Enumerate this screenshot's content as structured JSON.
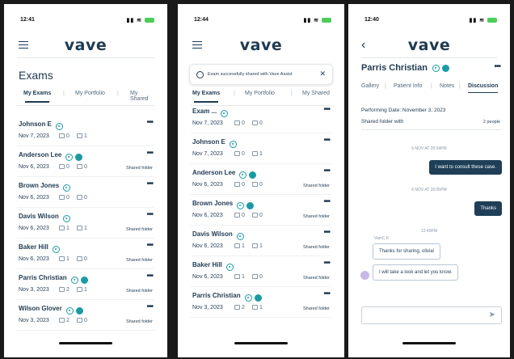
{
  "brand": "vave",
  "colors": {
    "navy": "#1f3a52",
    "teal": "#1a9aa5",
    "bubble": "#1e3f57"
  },
  "screen1": {
    "time": "12:41",
    "title": "Exams",
    "tabs": [
      "My Exams",
      "My Portfolio",
      "My Shared"
    ],
    "rows": [
      {
        "name": "Johnson E",
        "badge": false,
        "date": "Nov 7, 2023",
        "images": "0",
        "notes": "1",
        "shared": ""
      },
      {
        "name": "Anderson Lee",
        "badge": true,
        "date": "Nov 6, 2023",
        "images": "0",
        "notes": "0",
        "shared": "Shared folder"
      },
      {
        "name": "Brown Jones",
        "badge": false,
        "date": "Nov 6, 2023",
        "images": "0",
        "notes": "0",
        "shared": ""
      },
      {
        "name": "Davis Wilson",
        "badge": false,
        "date": "Nov 6, 2023",
        "images": "1",
        "notes": "1",
        "shared": "Shared folder"
      },
      {
        "name": "Baker Hill",
        "badge": false,
        "date": "Nov 6, 2023",
        "images": "1",
        "notes": "0",
        "shared": "Shared folder"
      },
      {
        "name": "Parris Christian",
        "badge": true,
        "date": "Nov 3, 2023",
        "images": "2",
        "notes": "1",
        "shared": "Shared folder"
      },
      {
        "name": "Wilson Glover",
        "badge": true,
        "date": "Nov 3, 2023",
        "images": "2",
        "notes": "0",
        "shared": "Shared folder"
      }
    ]
  },
  "screen2": {
    "time": "12:44",
    "toast": "Exam successfully shared with Vave Assist",
    "tabs": [
      "My Exams",
      "My Portfolio",
      "My Shared"
    ],
    "rows": [
      {
        "name": "Exam ...",
        "badge": false,
        "date": "Nov 7, 2023",
        "images": "0",
        "notes": "0",
        "shared": ""
      },
      {
        "name": "Johnson E",
        "badge": false,
        "date": "Nov 7, 2023",
        "images": "0",
        "notes": "1",
        "shared": ""
      },
      {
        "name": "Anderson Lee",
        "badge": true,
        "date": "Nov 6, 2023",
        "images": "0",
        "notes": "0",
        "shared": "Shared folder"
      },
      {
        "name": "Brown Jones",
        "badge": true,
        "date": "Nov 6, 2023",
        "images": "0",
        "notes": "0",
        "shared": "Shared folder"
      },
      {
        "name": "Davis Wilson",
        "badge": false,
        "date": "Nov 6, 2023",
        "images": "1",
        "notes": "1",
        "shared": "Shared folder"
      },
      {
        "name": "Baker Hill",
        "badge": false,
        "date": "Nov 6, 2023",
        "images": "1",
        "notes": "0",
        "shared": "Shared folder"
      },
      {
        "name": "Parris Christian",
        "badge": true,
        "date": "Nov 3, 2023",
        "images": "2",
        "notes": "1",
        "shared": "Shared folder"
      }
    ]
  },
  "screen3": {
    "time": "12:40",
    "patient": "Parris Christian",
    "subtabs": [
      "Gallery",
      "Patient Info",
      "Notes",
      "Discussion"
    ],
    "performing": "Performing Date: November 3, 2023",
    "shared_with": "Shared folder with",
    "people": "2 people",
    "messages": {
      "ts1": "6 NOV AT 20:04PM",
      "out1": "I want to consult these case.",
      "ts2": "6 NOV AT 20:05PM",
      "out2": "Thanks",
      "ts3": "12:40PM",
      "sender": "VamC K",
      "in1": "Thanks for sharing, olivia!",
      "in2": "I will take a look and let you know."
    }
  }
}
